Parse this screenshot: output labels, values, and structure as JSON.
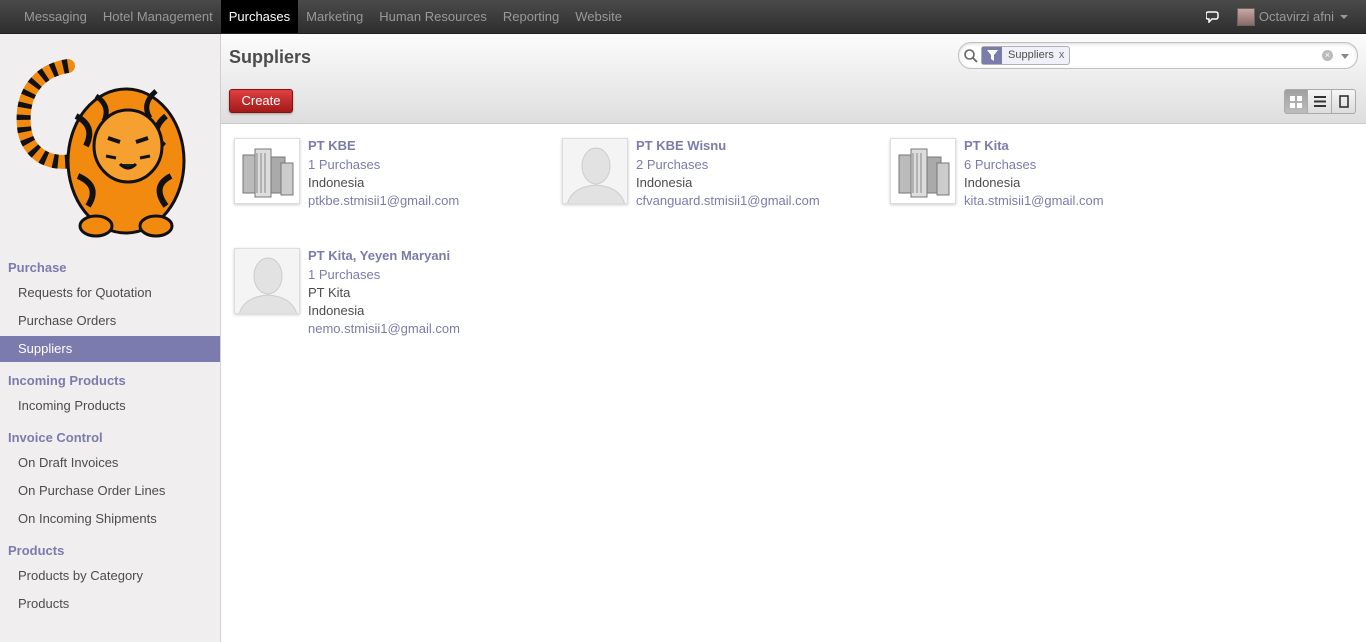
{
  "topmenu": [
    "Messaging",
    "Hotel Management",
    "Purchases",
    "Marketing",
    "Human Resources",
    "Reporting",
    "Website"
  ],
  "user": {
    "name": "Octavirzi afni"
  },
  "sidebar": {
    "sections": [
      {
        "title": "Purchase",
        "items": [
          "Requests for Quotation",
          "Purchase Orders",
          "Suppliers"
        ]
      },
      {
        "title": "Incoming Products",
        "items": [
          "Incoming Products"
        ]
      },
      {
        "title": "Invoice Control",
        "items": [
          "On Draft Invoices",
          "On Purchase Order Lines",
          "On Incoming Shipments"
        ]
      },
      {
        "title": "Products",
        "items": [
          "Products by Category",
          "Products"
        ]
      }
    ],
    "active": "Suppliers"
  },
  "header": {
    "title": "Suppliers",
    "create_label": "Create",
    "search": {
      "facet_value": "Suppliers",
      "facet_close": "x"
    }
  },
  "cards": [
    {
      "name": "PT KBE",
      "purchases": "1 Purchases",
      "lines": [
        "Indonesia"
      ],
      "email": "ptkbe.stmisii1@gmail.com",
      "image": "company"
    },
    {
      "name": "PT KBE Wisnu",
      "purchases": "2 Purchases",
      "lines": [
        "Indonesia"
      ],
      "email": "cfvanguard.stmisii1@gmail.com",
      "image": "person"
    },
    {
      "name": "PT Kita",
      "purchases": "6 Purchases",
      "lines": [
        "Indonesia"
      ],
      "email": "kita.stmisii1@gmail.com",
      "image": "company"
    },
    {
      "name": "PT Kita, Yeyen Maryani",
      "purchases": "1 Purchases",
      "lines": [
        "PT Kita",
        "Indonesia"
      ],
      "email": "nemo.stmisii1@gmail.com",
      "image": "person"
    }
  ],
  "colors": {
    "accent": "#7c7bad",
    "create": "#c02a2a",
    "topbar": "#414141"
  }
}
